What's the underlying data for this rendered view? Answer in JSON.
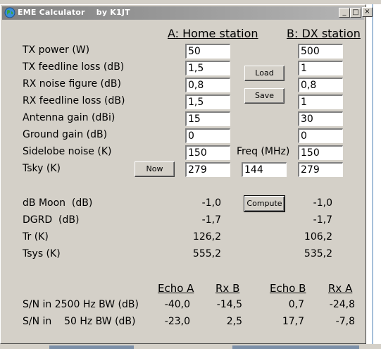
{
  "window": {
    "title": "EME Calculator    by K1JT",
    "minimize_glyph": "_",
    "maximize_glyph": "□",
    "close_glyph": "×"
  },
  "headers": {
    "home": "A: Home station",
    "dx": "B: DX station"
  },
  "params": [
    {
      "label": "TX power (W)",
      "home": "50",
      "dx": "500"
    },
    {
      "label": "TX feedline loss (dB)",
      "home": "1,5",
      "dx": "1"
    },
    {
      "label": "RX noise figure (dB)",
      "home": "0,8",
      "dx": "0,8"
    },
    {
      "label": "RX feedline loss (dB)",
      "home": "1,5",
      "dx": "1"
    },
    {
      "label": "Antenna gain (dBi)",
      "home": "15",
      "dx": "30"
    },
    {
      "label": "Ground gain (dB)",
      "home": "0",
      "dx": "0"
    },
    {
      "label": "Sidelobe noise (K)",
      "home": "150",
      "dx": "150"
    },
    {
      "label": "Tsky (K)",
      "home": "279",
      "dx": "279"
    }
  ],
  "buttons": {
    "load": "Load",
    "save": "Save",
    "now": "Now",
    "compute": "Compute"
  },
  "freq": {
    "label": "Freq (MHz)",
    "value": "144"
  },
  "results": [
    {
      "label": "dB Moon  (dB)",
      "home": "-1,0",
      "dx": "-1,0"
    },
    {
      "label": "DGRD  (dB)",
      "home": "-1,7",
      "dx": "-1,7"
    },
    {
      "label": "Tr (K)",
      "home": "126,2",
      "dx": "106,2"
    },
    {
      "label": "Tsys (K)",
      "home": "555,2",
      "dx": "535,2"
    }
  ],
  "sn": {
    "headers": [
      "Echo A",
      "Rx B",
      "Echo B",
      "Rx A"
    ],
    "rows": [
      {
        "label": "S/N in 2500 Hz BW (dB)",
        "values": [
          "-40,0",
          "-14,5",
          "0,7",
          "-24,8"
        ]
      },
      {
        "label": "S/N in    50 Hz BW (dB)",
        "values": [
          "-23,0",
          "2,5",
          "17,7",
          "-7,8"
        ]
      }
    ]
  }
}
